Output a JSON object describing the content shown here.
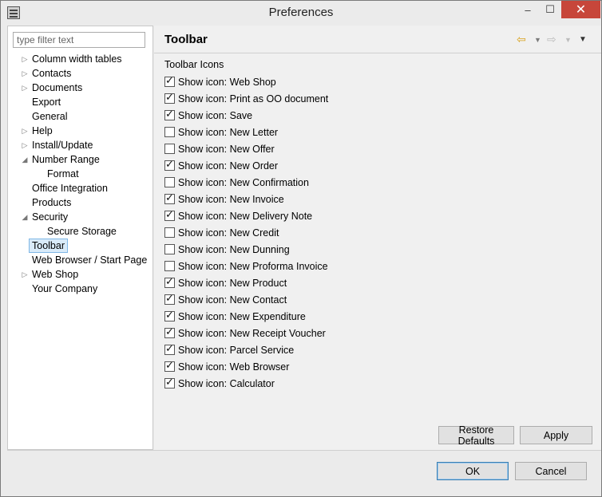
{
  "window": {
    "title": "Preferences"
  },
  "titlebar": {
    "minimize": "–",
    "maximize": "☐",
    "close": "✕"
  },
  "filter": {
    "placeholder": "type filter text"
  },
  "tree": [
    {
      "label": "Column width tables",
      "level": 0,
      "expandable": true,
      "expanded": false
    },
    {
      "label": "Contacts",
      "level": 0,
      "expandable": true,
      "expanded": false
    },
    {
      "label": "Documents",
      "level": 0,
      "expandable": true,
      "expanded": false
    },
    {
      "label": "Export",
      "level": 0,
      "expandable": false
    },
    {
      "label": "General",
      "level": 0,
      "expandable": false
    },
    {
      "label": "Help",
      "level": 0,
      "expandable": true,
      "expanded": false
    },
    {
      "label": "Install/Update",
      "level": 0,
      "expandable": true,
      "expanded": false
    },
    {
      "label": "Number Range",
      "level": 0,
      "expandable": true,
      "expanded": true
    },
    {
      "label": "Format",
      "level": 1,
      "expandable": false
    },
    {
      "label": "Office Integration",
      "level": 0,
      "expandable": false
    },
    {
      "label": "Products",
      "level": 0,
      "expandable": false
    },
    {
      "label": "Security",
      "level": 0,
      "expandable": true,
      "expanded": true
    },
    {
      "label": "Secure Storage",
      "level": 1,
      "expandable": false
    },
    {
      "label": "Toolbar",
      "level": 0,
      "expandable": false,
      "selected": true
    },
    {
      "label": "Web Browser / Start Page",
      "level": 0,
      "expandable": false
    },
    {
      "label": "Web Shop",
      "level": 0,
      "expandable": true,
      "expanded": false
    },
    {
      "label": "Your Company",
      "level": 0,
      "expandable": false
    }
  ],
  "page": {
    "title": "Toolbar",
    "group_title": "Toolbar Icons",
    "options": [
      {
        "label": "Show icon: Web Shop",
        "checked": true
      },
      {
        "label": "Show icon: Print as OO document",
        "checked": true
      },
      {
        "label": "Show icon: Save",
        "checked": true
      },
      {
        "label": "Show icon: New Letter",
        "checked": false
      },
      {
        "label": "Show icon: New Offer",
        "checked": false
      },
      {
        "label": "Show icon: New Order",
        "checked": true
      },
      {
        "label": "Show icon: New Confirmation",
        "checked": false
      },
      {
        "label": "Show icon: New Invoice",
        "checked": true
      },
      {
        "label": "Show icon: New Delivery Note",
        "checked": true
      },
      {
        "label": "Show icon: New Credit",
        "checked": false
      },
      {
        "label": "Show icon: New Dunning",
        "checked": false
      },
      {
        "label": "Show icon: New Proforma Invoice",
        "checked": false
      },
      {
        "label": "Show icon: New Product",
        "checked": true
      },
      {
        "label": "Show icon: New Contact",
        "checked": true
      },
      {
        "label": "Show icon: New Expenditure",
        "checked": true
      },
      {
        "label": "Show icon: New Receipt Voucher",
        "checked": true
      },
      {
        "label": "Show icon: Parcel Service",
        "checked": true
      },
      {
        "label": "Show icon: Web Browser",
        "checked": true
      },
      {
        "label": "Show icon: Calculator",
        "checked": true
      }
    ],
    "restore_label": "Restore Defaults",
    "apply_label": "Apply"
  },
  "nav": {
    "back_icon": "arrow-left-icon",
    "forward_icon": "arrow-right-icon",
    "menu_icon": "chevron-down-icon"
  },
  "dialog": {
    "ok_label": "OK",
    "cancel_label": "Cancel"
  },
  "colors": {
    "back_arrow": "#d9a21b",
    "close_button": "#c7463a",
    "selection": "#d9ebf9"
  }
}
